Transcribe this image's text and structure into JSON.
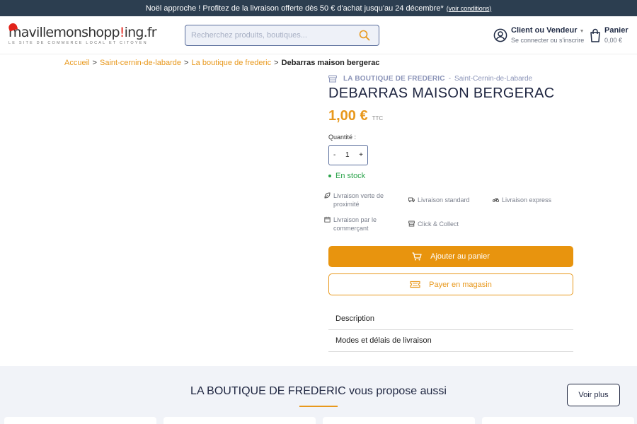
{
  "topbar": {
    "message": "Noël approche ! Profitez de la livraison offerte dès 50 € d'achat jusqu'au 24 décembre*",
    "link": "(voir conditions)"
  },
  "header": {
    "logo_main_a": "mavillemonshop",
    "logo_main_b": "p",
    "logo_main_c": "ing.fr",
    "logo_tagline": "LE SITE DE COMMERCE LOCAL ET CITOYEN",
    "search_placeholder": "Recherchez produits, boutiques...",
    "account_title": "Client ou Vendeur",
    "account_sub": "Se connecter ou s'inscrire",
    "cart_title": "Panier",
    "cart_amount": "0,00 €"
  },
  "breadcrumb": {
    "items": [
      "Accueil",
      "Saint-cernin-de-labarde",
      "La boutique de frederic"
    ],
    "separator": ">",
    "current": "Debarras maison bergerac"
  },
  "product": {
    "shop_name": "LA BOUTIQUE DE FREDERIC",
    "shop_sep": "-",
    "shop_city": "Saint-Cernin-de-Labarde",
    "title": "DEBARRAS MAISON BERGERAC",
    "price": "1,00 €",
    "price_suffix": "TTC",
    "qty_label": "Quantité :",
    "qty_minus": "-",
    "qty_value": "1",
    "qty_plus": "+",
    "stock": "En stock"
  },
  "delivery": {
    "green": "Livraison verte de proximité",
    "standard": "Livraison standard",
    "express": "Livraison express",
    "merchant": "Livraison par le commerçant",
    "click": "Click & Collect"
  },
  "actions": {
    "add_to_cart": "Ajouter au panier",
    "pay_in_store": "Payer en magasin"
  },
  "accordion": {
    "description": "Description",
    "delivery_modes": "Modes et délais de livraison"
  },
  "related": {
    "title": "LA BOUTIQUE DE FREDERIC vous propose aussi",
    "see_more": "Voir plus"
  },
  "colors": {
    "accent": "#e8981c",
    "topbar": "#2c3e50",
    "stock": "#2aa34a"
  }
}
